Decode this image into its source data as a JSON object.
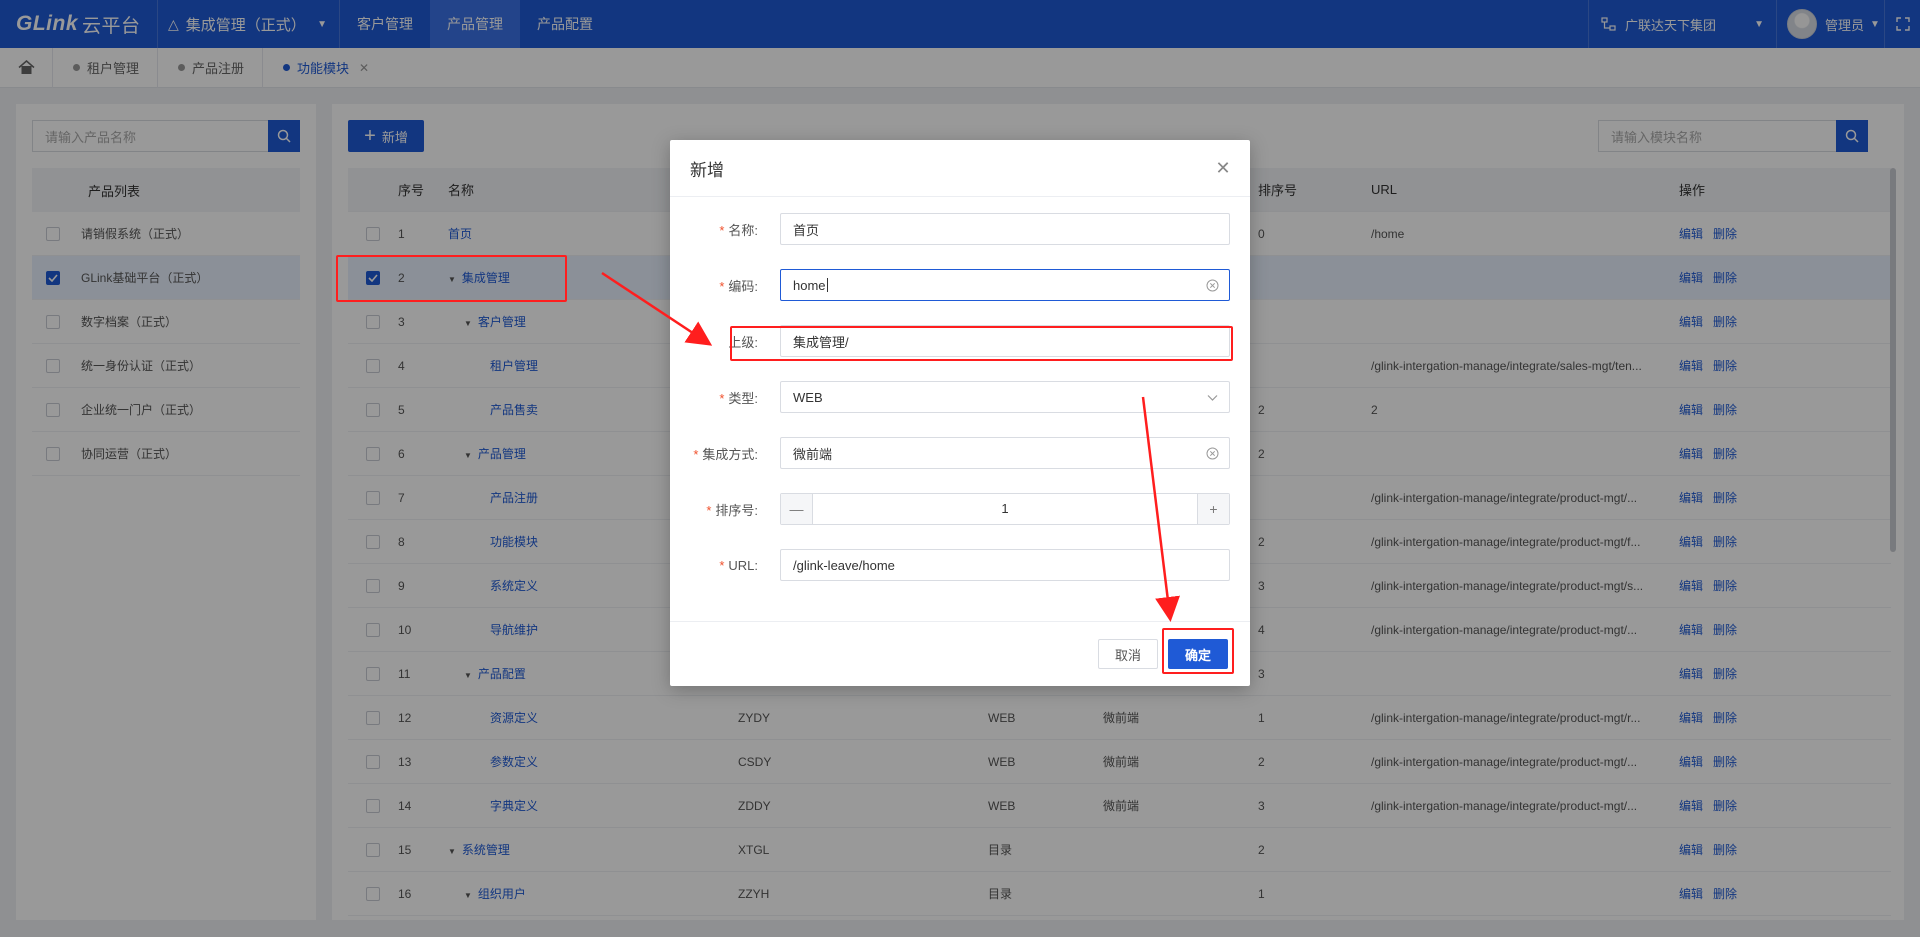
{
  "topbar": {
    "logo": "GLink",
    "logo_sub": "云平台",
    "app_switch": "集成管理（正式）",
    "nav": [
      "客户管理",
      "产品管理",
      "产品配置"
    ],
    "active_nav": "产品管理",
    "org": "广联达天下集团",
    "user": "管理员"
  },
  "tabs": [
    {
      "label": "租户管理",
      "active": false
    },
    {
      "label": "产品注册",
      "active": false
    },
    {
      "label": "功能模块",
      "active": true,
      "closable": true
    }
  ],
  "left": {
    "search_placeholder": "请输入产品名称",
    "header": "产品列表",
    "items": [
      {
        "label": "请销假系统（正式）",
        "checked": false
      },
      {
        "label": "GLink基础平台（正式）",
        "checked": true
      },
      {
        "label": "数字档案（正式）",
        "checked": false
      },
      {
        "label": "统一身份认证（正式）",
        "checked": false
      },
      {
        "label": "企业统一门户（正式）",
        "checked": false
      },
      {
        "label": "协同运营（正式）",
        "checked": false
      }
    ]
  },
  "main": {
    "add_button": "新增",
    "search_placeholder": "请输入模块名称",
    "columns": [
      "序号",
      "名称",
      "排序号",
      "URL",
      "操作"
    ],
    "edit_label": "编辑",
    "delete_label": "删除",
    "rows": [
      {
        "no": "1",
        "name": "首页",
        "level": 0,
        "expand": false,
        "code": "",
        "type": "",
        "mode": "",
        "sort": "0",
        "url": "/home",
        "checked": false
      },
      {
        "no": "2",
        "name": "集成管理",
        "level": 0,
        "expand": true,
        "code": "",
        "type": "",
        "mode": "",
        "sort": "",
        "url": "",
        "checked": true
      },
      {
        "no": "3",
        "name": "客户管理",
        "level": 1,
        "expand": true,
        "code": "",
        "type": "",
        "mode": "",
        "sort": "",
        "url": "",
        "checked": false
      },
      {
        "no": "4",
        "name": "租户管理",
        "level": 2,
        "expand": false,
        "code": "",
        "type": "",
        "mode": "",
        "sort": "",
        "url": "/glink-intergation-manage/integrate/sales-mgt/ten...",
        "checked": false
      },
      {
        "no": "5",
        "name": "产品售卖",
        "level": 2,
        "expand": false,
        "code": "",
        "type": "",
        "mode": "",
        "sort": "2",
        "url": "2",
        "checked": false
      },
      {
        "no": "6",
        "name": "产品管理",
        "level": 1,
        "expand": true,
        "code": "",
        "type": "",
        "mode": "",
        "sort": "2",
        "url": "",
        "checked": false
      },
      {
        "no": "7",
        "name": "产品注册",
        "level": 2,
        "expand": false,
        "code": "",
        "type": "",
        "mode": "",
        "sort": "",
        "url": "/glink-intergation-manage/integrate/product-mgt/...",
        "checked": false
      },
      {
        "no": "8",
        "name": "功能模块",
        "level": 2,
        "expand": false,
        "code": "",
        "type": "",
        "mode": "",
        "sort": "2",
        "url": "/glink-intergation-manage/integrate/product-mgt/f...",
        "checked": false
      },
      {
        "no": "9",
        "name": "系统定义",
        "level": 2,
        "expand": false,
        "code": "",
        "type": "",
        "mode": "",
        "sort": "3",
        "url": "/glink-intergation-manage/integrate/product-mgt/s...",
        "checked": false
      },
      {
        "no": "10",
        "name": "导航维护",
        "level": 2,
        "expand": false,
        "code": "",
        "type": "",
        "mode": "",
        "sort": "4",
        "url": "/glink-intergation-manage/integrate/product-mgt/...",
        "checked": false
      },
      {
        "no": "11",
        "name": "产品配置",
        "level": 1,
        "expand": true,
        "code": "",
        "type": "",
        "mode": "",
        "sort": "3",
        "url": "",
        "checked": false
      },
      {
        "no": "12",
        "name": "资源定义",
        "level": 2,
        "expand": false,
        "code": "ZYDY",
        "type": "WEB",
        "mode": "微前端",
        "sort": "1",
        "url": "/glink-intergation-manage/integrate/product-mgt/r...",
        "checked": false
      },
      {
        "no": "13",
        "name": "参数定义",
        "level": 2,
        "expand": false,
        "code": "CSDY",
        "type": "WEB",
        "mode": "微前端",
        "sort": "2",
        "url": "/glink-intergation-manage/integrate/product-mgt/...",
        "checked": false
      },
      {
        "no": "14",
        "name": "字典定义",
        "level": 2,
        "expand": false,
        "code": "ZDDY",
        "type": "WEB",
        "mode": "微前端",
        "sort": "3",
        "url": "/glink-intergation-manage/integrate/product-mgt/...",
        "checked": false
      },
      {
        "no": "15",
        "name": "系统管理",
        "level": 0,
        "expand": true,
        "code": "XTGL",
        "type": "目录",
        "mode": "",
        "sort": "2",
        "url": "",
        "checked": false
      },
      {
        "no": "16",
        "name": "组织用户",
        "level": 1,
        "expand": true,
        "code": "ZZYH",
        "type": "目录",
        "mode": "",
        "sort": "1",
        "url": "",
        "checked": false
      }
    ]
  },
  "modal": {
    "title": "新增",
    "fields": {
      "name": {
        "label": "名称:",
        "value": "首页",
        "required": true
      },
      "code": {
        "label": "编码:",
        "value": "home",
        "required": true
      },
      "parent": {
        "label": "上级:",
        "value": "集成管理/",
        "required": false
      },
      "type": {
        "label": "类型:",
        "value": "WEB",
        "required": true
      },
      "mode": {
        "label": "集成方式:",
        "value": "微前端",
        "required": true
      },
      "sort": {
        "label": "排序号:",
        "value": "1",
        "required": true
      },
      "url": {
        "label": "URL:",
        "value": "/glink-leave/home",
        "required": true
      }
    },
    "cancel": "取消",
    "ok": "确定"
  },
  "colors": {
    "primary": "#1f5ad6",
    "annotation": "#ff1e1e"
  }
}
